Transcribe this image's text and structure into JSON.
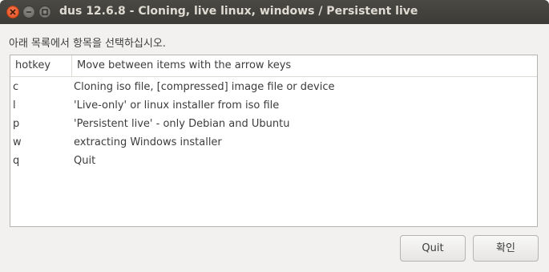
{
  "window": {
    "title": "dus 12.6.8 - Cloning, live linux, windows / Persistent live",
    "controls": {
      "close_icon": "close-icon",
      "minimize_icon": "minimize-icon",
      "maximize_icon": "maximize-icon"
    }
  },
  "prompt": "아래 목록에서 항목을 선택하십시오.",
  "list": {
    "columns": [
      "hotkey",
      "Move between items with the arrow keys"
    ],
    "rows": [
      {
        "key": "c",
        "desc": "Cloning iso file, [compressed] image file or device"
      },
      {
        "key": "l",
        "desc": "'Live-only' or linux installer from iso file"
      },
      {
        "key": "p",
        "desc": "'Persistent live' - only Debian and Ubuntu"
      },
      {
        "key": "w",
        "desc": "extracting Windows installer"
      },
      {
        "key": "q",
        "desc": "Quit"
      }
    ]
  },
  "buttons": {
    "quit": "Quit",
    "ok": "확인"
  },
  "colors": {
    "titlebar": "#3c3b37",
    "close_button": "#e2501f",
    "window_bg": "#f2f1f0"
  }
}
